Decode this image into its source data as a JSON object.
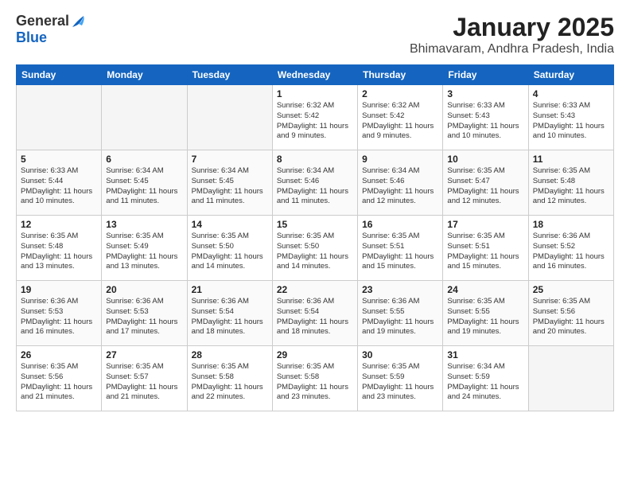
{
  "logo": {
    "general": "General",
    "blue": "Blue"
  },
  "title": "January 2025",
  "subtitle": "Bhimavaram, Andhra Pradesh, India",
  "days": [
    "Sunday",
    "Monday",
    "Tuesday",
    "Wednesday",
    "Thursday",
    "Friday",
    "Saturday"
  ],
  "weeks": [
    [
      {
        "day": "",
        "content": ""
      },
      {
        "day": "",
        "content": ""
      },
      {
        "day": "",
        "content": ""
      },
      {
        "day": "1",
        "content": "Sunrise: 6:32 AM\nSunset: 5:42 PM\nDaylight: 11 hours\nand 9 minutes."
      },
      {
        "day": "2",
        "content": "Sunrise: 6:32 AM\nSunset: 5:42 PM\nDaylight: 11 hours\nand 9 minutes."
      },
      {
        "day": "3",
        "content": "Sunrise: 6:33 AM\nSunset: 5:43 PM\nDaylight: 11 hours\nand 10 minutes."
      },
      {
        "day": "4",
        "content": "Sunrise: 6:33 AM\nSunset: 5:43 PM\nDaylight: 11 hours\nand 10 minutes."
      }
    ],
    [
      {
        "day": "5",
        "content": "Sunrise: 6:33 AM\nSunset: 5:44 PM\nDaylight: 11 hours\nand 10 minutes."
      },
      {
        "day": "6",
        "content": "Sunrise: 6:34 AM\nSunset: 5:45 PM\nDaylight: 11 hours\nand 11 minutes."
      },
      {
        "day": "7",
        "content": "Sunrise: 6:34 AM\nSunset: 5:45 PM\nDaylight: 11 hours\nand 11 minutes."
      },
      {
        "day": "8",
        "content": "Sunrise: 6:34 AM\nSunset: 5:46 PM\nDaylight: 11 hours\nand 11 minutes."
      },
      {
        "day": "9",
        "content": "Sunrise: 6:34 AM\nSunset: 5:46 PM\nDaylight: 11 hours\nand 12 minutes."
      },
      {
        "day": "10",
        "content": "Sunrise: 6:35 AM\nSunset: 5:47 PM\nDaylight: 11 hours\nand 12 minutes."
      },
      {
        "day": "11",
        "content": "Sunrise: 6:35 AM\nSunset: 5:48 PM\nDaylight: 11 hours\nand 12 minutes."
      }
    ],
    [
      {
        "day": "12",
        "content": "Sunrise: 6:35 AM\nSunset: 5:48 PM\nDaylight: 11 hours\nand 13 minutes."
      },
      {
        "day": "13",
        "content": "Sunrise: 6:35 AM\nSunset: 5:49 PM\nDaylight: 11 hours\nand 13 minutes."
      },
      {
        "day": "14",
        "content": "Sunrise: 6:35 AM\nSunset: 5:50 PM\nDaylight: 11 hours\nand 14 minutes."
      },
      {
        "day": "15",
        "content": "Sunrise: 6:35 AM\nSunset: 5:50 PM\nDaylight: 11 hours\nand 14 minutes."
      },
      {
        "day": "16",
        "content": "Sunrise: 6:35 AM\nSunset: 5:51 PM\nDaylight: 11 hours\nand 15 minutes."
      },
      {
        "day": "17",
        "content": "Sunrise: 6:35 AM\nSunset: 5:51 PM\nDaylight: 11 hours\nand 15 minutes."
      },
      {
        "day": "18",
        "content": "Sunrise: 6:36 AM\nSunset: 5:52 PM\nDaylight: 11 hours\nand 16 minutes."
      }
    ],
    [
      {
        "day": "19",
        "content": "Sunrise: 6:36 AM\nSunset: 5:53 PM\nDaylight: 11 hours\nand 16 minutes."
      },
      {
        "day": "20",
        "content": "Sunrise: 6:36 AM\nSunset: 5:53 PM\nDaylight: 11 hours\nand 17 minutes."
      },
      {
        "day": "21",
        "content": "Sunrise: 6:36 AM\nSunset: 5:54 PM\nDaylight: 11 hours\nand 18 minutes."
      },
      {
        "day": "22",
        "content": "Sunrise: 6:36 AM\nSunset: 5:54 PM\nDaylight: 11 hours\nand 18 minutes."
      },
      {
        "day": "23",
        "content": "Sunrise: 6:36 AM\nSunset: 5:55 PM\nDaylight: 11 hours\nand 19 minutes."
      },
      {
        "day": "24",
        "content": "Sunrise: 6:35 AM\nSunset: 5:55 PM\nDaylight: 11 hours\nand 19 minutes."
      },
      {
        "day": "25",
        "content": "Sunrise: 6:35 AM\nSunset: 5:56 PM\nDaylight: 11 hours\nand 20 minutes."
      }
    ],
    [
      {
        "day": "26",
        "content": "Sunrise: 6:35 AM\nSunset: 5:56 PM\nDaylight: 11 hours\nand 21 minutes."
      },
      {
        "day": "27",
        "content": "Sunrise: 6:35 AM\nSunset: 5:57 PM\nDaylight: 11 hours\nand 21 minutes."
      },
      {
        "day": "28",
        "content": "Sunrise: 6:35 AM\nSunset: 5:58 PM\nDaylight: 11 hours\nand 22 minutes."
      },
      {
        "day": "29",
        "content": "Sunrise: 6:35 AM\nSunset: 5:58 PM\nDaylight: 11 hours\nand 23 minutes."
      },
      {
        "day": "30",
        "content": "Sunrise: 6:35 AM\nSunset: 5:59 PM\nDaylight: 11 hours\nand 23 minutes."
      },
      {
        "day": "31",
        "content": "Sunrise: 6:34 AM\nSunset: 5:59 PM\nDaylight: 11 hours\nand 24 minutes."
      },
      {
        "day": "",
        "content": ""
      }
    ]
  ]
}
